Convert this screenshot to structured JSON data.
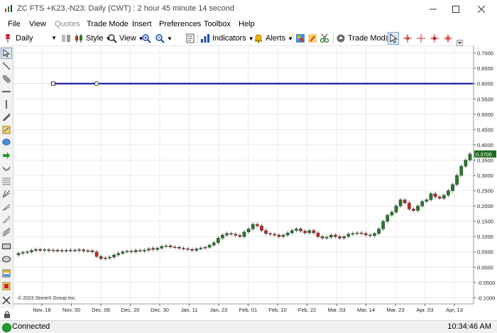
{
  "window": {
    "title": "ZC FTS +K23,-N23: Daily (CWT) : 2 hour 45 minute 14 second"
  },
  "menu": [
    {
      "label": "File",
      "disabled": false
    },
    {
      "label": "View",
      "disabled": false
    },
    {
      "label": "Quotes",
      "disabled": true
    },
    {
      "label": "Trade Mode",
      "disabled": false
    },
    {
      "label": "Insert",
      "disabled": false
    },
    {
      "label": "Preferences",
      "disabled": false
    },
    {
      "label": "Toolbox",
      "disabled": false
    },
    {
      "label": "Help",
      "disabled": false
    }
  ],
  "toolbar": {
    "interval": "Daily",
    "style_label": "Style",
    "view_label": "View",
    "indicators_label": "Indicators",
    "alerts_label": "Alerts",
    "trade_mode_label": "Trade Mode"
  },
  "colors": {
    "accent": "#1f1fa8",
    "up": "#2a7a2a",
    "down": "#c8272b",
    "grid": "#d8d8d8",
    "last_price_bg": "#1e6b1e"
  },
  "status": {
    "connection": "Connected",
    "time": "10:34:46 AM"
  },
  "chart_data": {
    "type": "candlestick",
    "copyright": "© 2023 StoneX Group Inc.",
    "last_price_label": "0.3700",
    "ylim": [
      -0.12,
      0.72
    ],
    "yticks": [
      -0.1,
      -0.05,
      0.0,
      0.05,
      0.1,
      0.15,
      0.2,
      0.25,
      0.3,
      0.35,
      0.4,
      0.45,
      0.5,
      0.55,
      0.6,
      0.65,
      0.7
    ],
    "ytick_labels": [
      "-0.1000",
      "-0.0500",
      "0.0000",
      "0.0500",
      "0.1000",
      "0.1500",
      "0.2000",
      "0.2500",
      "0.3000",
      "0.3500",
      "0.4000",
      "0.4500",
      "0.5000",
      "0.5500",
      "0.6000",
      "0.6500",
      "0.7000"
    ],
    "x_labels": [
      "Nov, 18",
      "Nov, 30",
      "Dec, 09",
      "Dec, 20",
      "Dec, 30",
      "Jan, 11",
      "Jan, 23",
      "Feb, 01",
      "Feb, 10",
      "Feb, 22",
      "Mar, 03",
      "Mar, 14",
      "Mar, 23",
      "Apr, 03",
      "Apr, 13"
    ],
    "horizontal_line": {
      "value": 0.6,
      "start_bar": 8,
      "handle_bar": 18
    },
    "closes": [
      0.045,
      0.048,
      0.05,
      0.055,
      0.058,
      0.055,
      0.057,
      0.054,
      0.056,
      0.053,
      0.055,
      0.054,
      0.056,
      0.055,
      0.057,
      0.053,
      0.054,
      0.05,
      0.035,
      0.028,
      0.03,
      0.033,
      0.04,
      0.045,
      0.05,
      0.052,
      0.05,
      0.055,
      0.053,
      0.056,
      0.06,
      0.058,
      0.062,
      0.068,
      0.07,
      0.066,
      0.065,
      0.062,
      0.06,
      0.058,
      0.055,
      0.06,
      0.063,
      0.065,
      0.072,
      0.08,
      0.095,
      0.105,
      0.11,
      0.108,
      0.104,
      0.1,
      0.115,
      0.125,
      0.14,
      0.135,
      0.12,
      0.11,
      0.108,
      0.105,
      0.1,
      0.105,
      0.112,
      0.12,
      0.125,
      0.118,
      0.112,
      0.12,
      0.112,
      0.1,
      0.095,
      0.098,
      0.105,
      0.1,
      0.095,
      0.1,
      0.108,
      0.11,
      0.112,
      0.11,
      0.105,
      0.103,
      0.11,
      0.125,
      0.15,
      0.17,
      0.18,
      0.2,
      0.22,
      0.21,
      0.19,
      0.185,
      0.2,
      0.215,
      0.22,
      0.24,
      0.23,
      0.225,
      0.235,
      0.25,
      0.27,
      0.3,
      0.33,
      0.35,
      0.37
    ],
    "opens": [
      0.04,
      0.045,
      0.048,
      0.05,
      0.055,
      0.058,
      0.055,
      0.057,
      0.054,
      0.056,
      0.053,
      0.055,
      0.054,
      0.056,
      0.055,
      0.057,
      0.053,
      0.054,
      0.05,
      0.035,
      0.028,
      0.03,
      0.033,
      0.04,
      0.045,
      0.052,
      0.052,
      0.05,
      0.055,
      0.053,
      0.056,
      0.062,
      0.058,
      0.062,
      0.068,
      0.07,
      0.066,
      0.065,
      0.062,
      0.06,
      0.058,
      0.055,
      0.06,
      0.063,
      0.065,
      0.072,
      0.08,
      0.095,
      0.105,
      0.11,
      0.108,
      0.104,
      0.1,
      0.115,
      0.125,
      0.14,
      0.135,
      0.12,
      0.11,
      0.108,
      0.105,
      0.1,
      0.105,
      0.112,
      0.12,
      0.125,
      0.118,
      0.112,
      0.12,
      0.112,
      0.1,
      0.095,
      0.098,
      0.105,
      0.1,
      0.095,
      0.1,
      0.108,
      0.11,
      0.112,
      0.11,
      0.105,
      0.103,
      0.11,
      0.125,
      0.15,
      0.17,
      0.18,
      0.2,
      0.22,
      0.21,
      0.19,
      0.185,
      0.2,
      0.215,
      0.22,
      0.24,
      0.23,
      0.225,
      0.235,
      0.25,
      0.27,
      0.3,
      0.33,
      0.35
    ]
  }
}
